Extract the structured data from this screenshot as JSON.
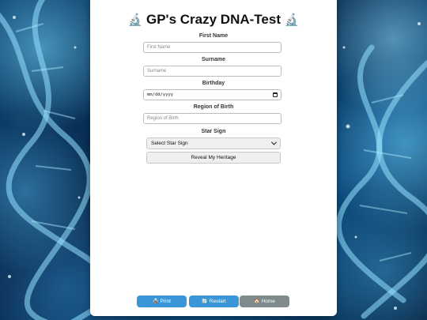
{
  "page": {
    "title": "GP's Crazy DNA-Test",
    "title_icon": "microscope-icon",
    "title_icon_glyph": "🔬"
  },
  "form": {
    "first_name": {
      "label": "First Name",
      "placeholder": "First Name",
      "value": ""
    },
    "surname": {
      "label": "Surname",
      "placeholder": "Surname",
      "value": ""
    },
    "birthday": {
      "label": "Birthday",
      "placeholder": "mm/dd/yyyy",
      "value": ""
    },
    "region": {
      "label": "Region of Birth",
      "placeholder": "Region of Birth",
      "value": ""
    },
    "star_sign": {
      "label": "Star Sign",
      "selected": "Select Star Sign"
    },
    "submit_label": "Reveal My Heritage"
  },
  "nav": {
    "print": {
      "label": "Print",
      "icon": "printer-icon",
      "glyph": "🖨️",
      "color": "#3a96d6"
    },
    "restart": {
      "label": "Restart",
      "icon": "refresh-icon",
      "glyph": "🔄",
      "color": "#3a96d6"
    },
    "home": {
      "label": "Home",
      "icon": "house-icon",
      "glyph": "🏠",
      "color": "#7f8a8c"
    }
  }
}
